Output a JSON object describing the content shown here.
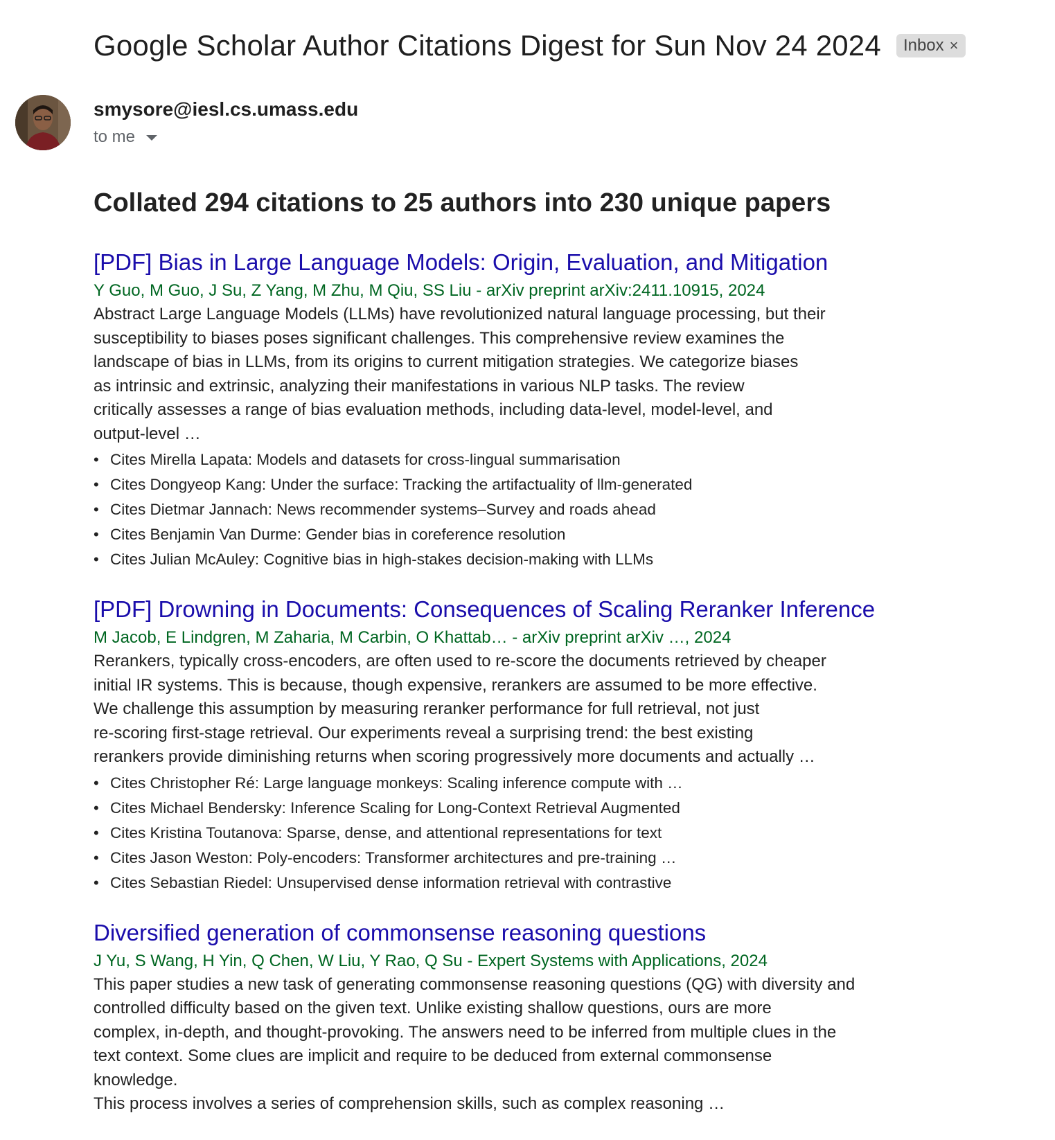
{
  "email": {
    "subject": "Google Scholar Author Citations Digest for Sun Nov 24 2024",
    "label": "Inbox",
    "label_remove": "×",
    "sender": "smysore@iesl.cs.umass.edu",
    "recipient": "to me"
  },
  "digest": {
    "summary": "Collated 294 citations to 25 authors into 230 unique papers",
    "papers": [
      {
        "title": "[PDF] Bias in Large Language Models: Origin, Evaluation, and Mitigation",
        "authors": "Y Guo, M Guo, J Su, Z Yang, M Zhu, M Qiu, SS Liu - arXiv preprint arXiv:2411.10915, 2024",
        "abstract_lines": [
          "Abstract Large Language Models (LLMs) have revolutionized natural language processing, but their",
          "susceptibility to biases poses significant challenges. This comprehensive review examines the",
          "landscape of bias in LLMs, from its origins to current mitigation strategies. We categorize biases",
          "as intrinsic and extrinsic, analyzing their manifestations in various NLP tasks. The review",
          "critically assesses a range of bias evaluation methods, including data-level, model-level, and",
          "output-level …"
        ],
        "cites": [
          "Cites Mirella Lapata: Models and datasets for cross-lingual summarisation",
          "Cites Dongyeop Kang: Under the surface: Tracking the artifactuality of llm-generated",
          "Cites Dietmar Jannach: News recommender systems–Survey and roads ahead",
          "Cites Benjamin Van Durme: Gender bias in coreference resolution",
          "Cites Julian McAuley: Cognitive bias in high-stakes decision-making with LLMs"
        ]
      },
      {
        "title": "[PDF] Drowning in Documents: Consequences of Scaling Reranker Inference",
        "authors": "M Jacob, E Lindgren, M Zaharia, M Carbin, O Khattab… - arXiv preprint arXiv …, 2024",
        "abstract_lines": [
          "Rerankers, typically cross-encoders, are often used to re-score the documents retrieved by cheaper",
          "initial IR systems. This is because, though expensive, rerankers are assumed to be more effective.",
          "We challenge this assumption by measuring reranker performance for full retrieval, not just",
          "re-scoring first-stage retrieval. Our experiments reveal a surprising trend: the best existing",
          "rerankers provide diminishing returns when scoring progressively more documents and actually …"
        ],
        "cites": [
          "Cites Christopher Ré: Large language monkeys: Scaling inference compute with …",
          "Cites Michael Bendersky: Inference Scaling for Long-Context Retrieval Augmented",
          "Cites Kristina Toutanova: Sparse, dense, and attentional representations for text",
          "Cites Jason Weston: Poly-encoders: Transformer architectures and pre-training …",
          "Cites Sebastian Riedel: Unsupervised dense information retrieval with contrastive"
        ]
      },
      {
        "title": "Diversified generation of commonsense reasoning questions",
        "authors": "J Yu, S Wang, H Yin, Q Chen, W Liu, Y Rao, Q Su - Expert Systems with Applications, 2024",
        "abstract_lines": [
          "This paper studies a new task of generating commonsense reasoning questions (QG) with diversity and",
          "controlled difficulty based on the given text. Unlike existing shallow questions, ours are more",
          "complex, in-depth, and thought-provoking. The answers need to be inferred from multiple clues in the",
          "text context. Some clues are implicit and require to be deduced from external commonsense",
          "knowledge.",
          "This process involves a series of comprehension skills, such as complex reasoning …"
        ],
        "cites": []
      }
    ]
  }
}
